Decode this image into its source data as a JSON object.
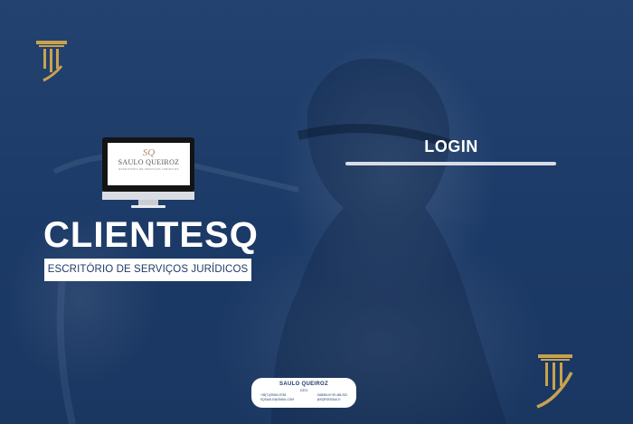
{
  "login": {
    "title": "LOGIN"
  },
  "brand": {
    "title": "CLIENTESQ",
    "tagline": "ESCRITÓRIO DE SERVIÇOS JURÍDICOS"
  },
  "monitor_logo": {
    "mark": "SQ",
    "name": "SAULO QUEIROZ",
    "sub": "ESCRITÓRIO DE SERVIÇOS JURÍDICOS"
  },
  "card": {
    "name": "SAULO QUEIROZ",
    "role": "CEO",
    "phone": "+55(71)99184-9738",
    "email": "SQSAULO@GMAIL.COM",
    "oab": "OAB/BA Nº 59.465-S02",
    "handle": "@SQRODSAULO"
  },
  "colors": {
    "background": "#1f3a66",
    "accent_gold": "#c9a24f",
    "white": "#ffffff"
  },
  "icons": {
    "top_left": "column-logo-icon",
    "bottom_right": "column-scale-logo-icon"
  }
}
